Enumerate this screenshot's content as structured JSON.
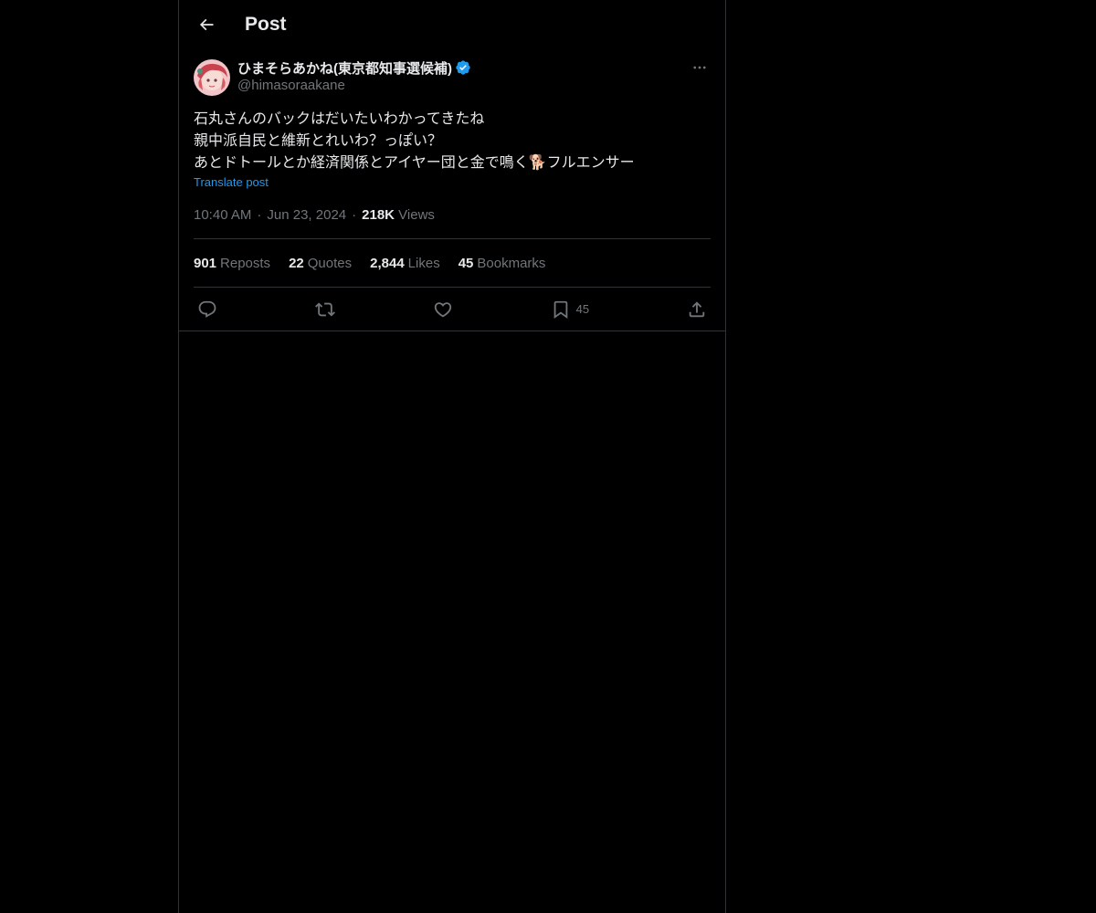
{
  "header": {
    "back_icon": "arrow-left-icon",
    "title": "Post"
  },
  "tweet": {
    "author": {
      "display_name": "ひまそらあかね(東京都知事選候補)",
      "handle": "@himasoraakane",
      "verified_icon": "verified-badge-icon",
      "verified_color": "#1d9bf0"
    },
    "more_icon": "more-horizontal-icon",
    "text_lines": [
      "石丸さんのバックはだいたいわかってきたね",
      "親中派自民と維新とれいわ？っぽい？",
      "あとドトールとか経済関係とアイヤー団と金で鳴く🐕フルエンサー"
    ],
    "translate_label": "Translate post",
    "time": "10:40 AM",
    "date": "Jun 23, 2024",
    "views_count": "218K",
    "views_label": "Views",
    "separator": "·"
  },
  "stats": {
    "reposts": {
      "count": "901",
      "label": "Reposts"
    },
    "quotes": {
      "count": "22",
      "label": "Quotes"
    },
    "likes": {
      "count": "2,844",
      "label": "Likes"
    },
    "bookmarks": {
      "count": "45",
      "label": "Bookmarks"
    }
  },
  "actions": {
    "reply_icon": "reply-icon",
    "repost_icon": "repost-icon",
    "like_icon": "heart-icon",
    "bookmark_icon": "bookmark-icon",
    "bookmark_count": "45",
    "share_icon": "share-icon"
  },
  "colors": {
    "background": "#000000",
    "text": "#e7e9ea",
    "muted": "#71767b",
    "accent": "#1d9bf0",
    "border": "#2f3336"
  }
}
